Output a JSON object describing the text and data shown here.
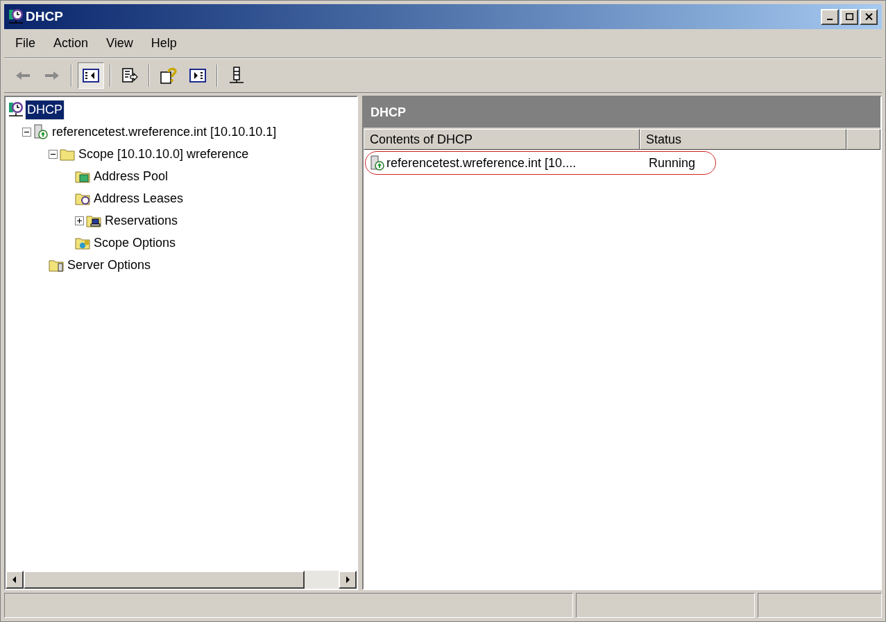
{
  "window": {
    "title": "DHCP"
  },
  "menu": [
    "File",
    "Action",
    "View",
    "Help"
  ],
  "toolbar": [
    {
      "kind": "back",
      "disabled": true
    },
    {
      "kind": "forward",
      "disabled": true
    },
    {
      "kind": "separator"
    },
    {
      "kind": "tree",
      "pressed": true
    },
    {
      "kind": "separator"
    },
    {
      "kind": "export",
      "pressed": false
    },
    {
      "kind": "separator"
    },
    {
      "kind": "help",
      "pressed": false
    },
    {
      "kind": "pane",
      "pressed": false
    },
    {
      "kind": "separator"
    },
    {
      "kind": "server",
      "pressed": false
    }
  ],
  "tree": [
    {
      "label": "DHCP",
      "kind": "dhcp",
      "selected": true,
      "children": [
        {
          "label": "referencetest.wreference.int [10.10.10.1]",
          "kind": "server",
          "selected": false,
          "expanded": true,
          "children": [
            {
              "label": "Scope [10.10.10.0] wreference",
              "kind": "folder",
              "selected": false,
              "expanded": true,
              "children": [
                {
                  "label": "Address Pool",
                  "kind": "pool",
                  "selected": false
                },
                {
                  "label": "Address Leases",
                  "kind": "leases",
                  "selected": false
                },
                {
                  "label": "Reservations",
                  "kind": "reservations",
                  "selected": false,
                  "expanded": false
                },
                {
                  "label": "Scope Options",
                  "kind": "options",
                  "selected": false
                }
              ]
            },
            {
              "label": "Server Options",
              "kind": "serveroptions",
              "selected": false
            }
          ]
        }
      ]
    }
  ],
  "details": {
    "title": "DHCP",
    "columns": [
      "Contents of DHCP",
      "Status"
    ],
    "rows": [
      {
        "name": "referencetest.wreference.int [10....",
        "status": "Running",
        "circled": true
      }
    ]
  }
}
